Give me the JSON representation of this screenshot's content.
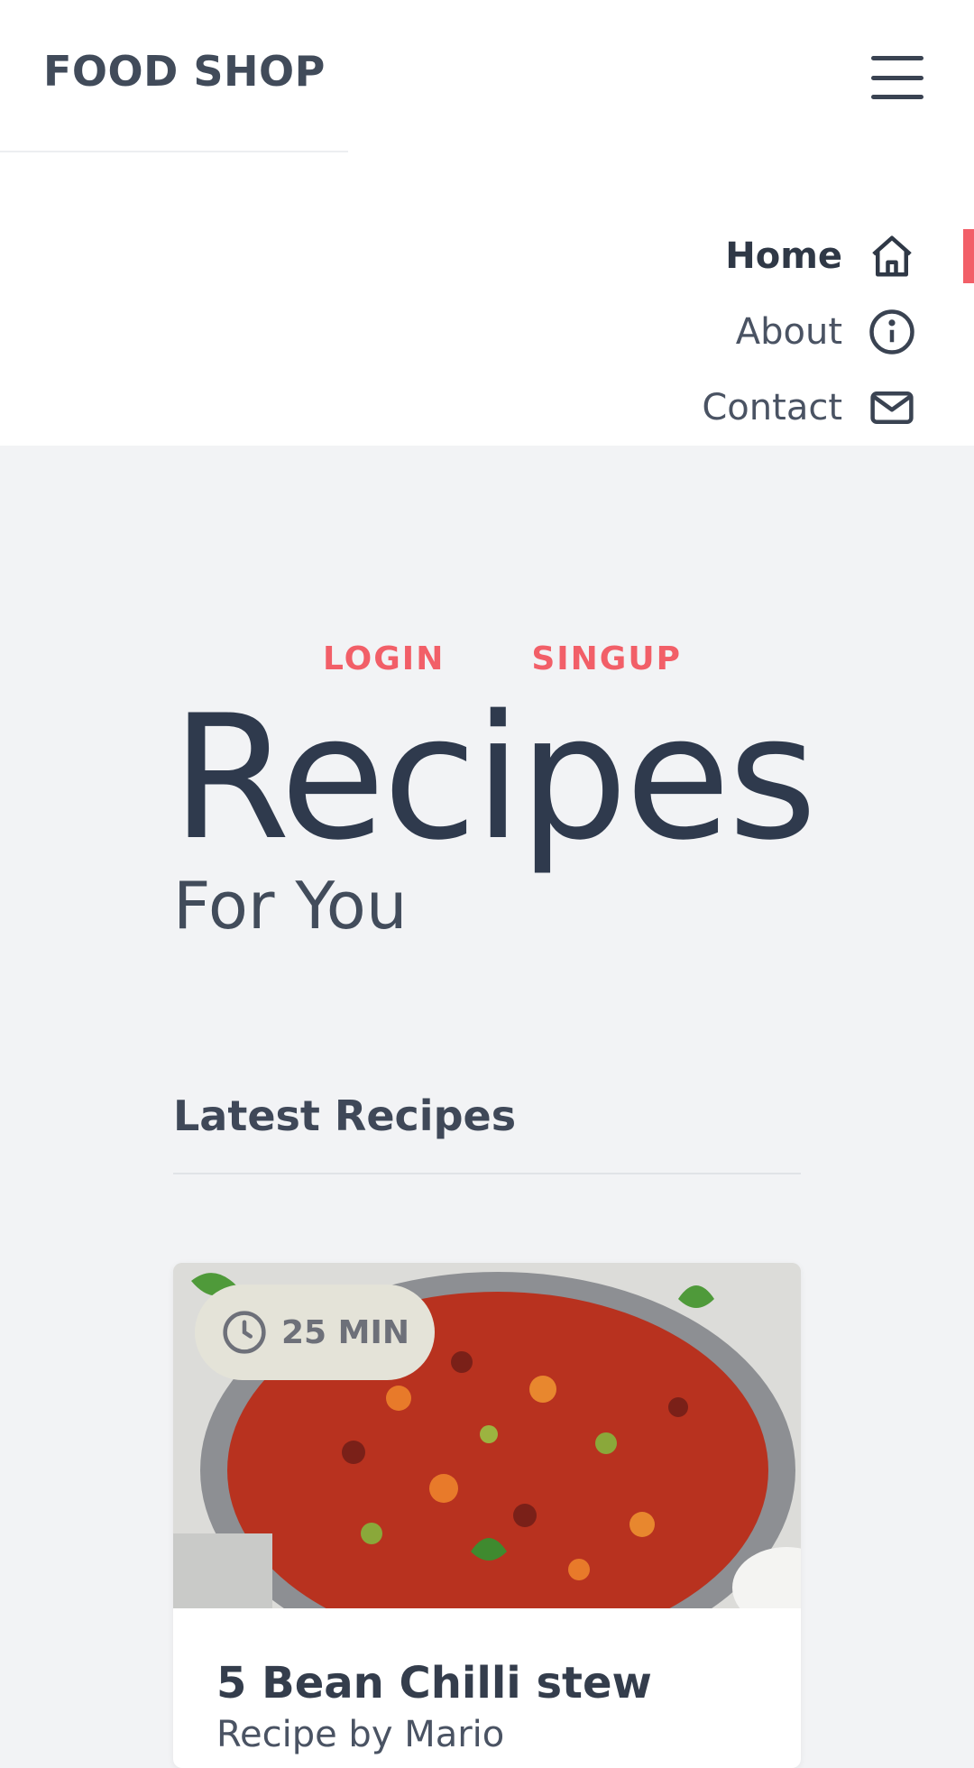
{
  "header": {
    "brand": "FOOD SHOP",
    "menu_icon": "hamburger-menu-icon"
  },
  "nav": {
    "items": [
      {
        "label": "Home",
        "icon": "home-icon",
        "active": true
      },
      {
        "label": "About",
        "icon": "info-icon",
        "active": false
      },
      {
        "label": "Contact",
        "icon": "mail-icon",
        "active": false
      }
    ]
  },
  "auth": {
    "login": "LOGIN",
    "signup": "SINGUP"
  },
  "hero": {
    "title": "Recipes",
    "subtitle": "For You"
  },
  "latest": {
    "heading": "Latest Recipes",
    "cards": [
      {
        "time": "25 MIN",
        "time_icon": "clock-icon",
        "title": "5 Bean Chilli stew",
        "subtitle": "Recipe by Mario"
      }
    ]
  },
  "colors": {
    "accent": "#f25f68",
    "text_dark": "#2f3a4d",
    "background": "#f2f3f5",
    "header_bg": "#ffffff"
  }
}
